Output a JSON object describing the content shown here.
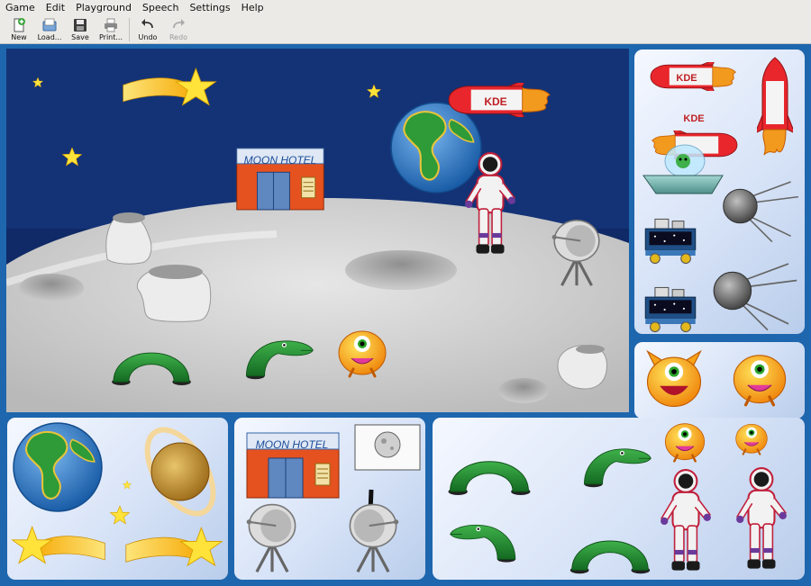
{
  "menu": {
    "items": [
      {
        "label": "Game",
        "key": "G"
      },
      {
        "label": "Edit",
        "key": "E"
      },
      {
        "label": "Playground",
        "key": "P"
      },
      {
        "label": "Speech",
        "key": "S"
      },
      {
        "label": "Settings",
        "key": "S"
      },
      {
        "label": "Help",
        "key": "H"
      }
    ]
  },
  "toolbar": {
    "new_label": "New",
    "load_label": "Load...",
    "save_label": "Save",
    "print_label": "Print...",
    "undo_label": "Undo",
    "redo_label": "Redo"
  },
  "scene": {
    "hotel_sign": "MOON HOTEL",
    "rocket_text": "KDE"
  },
  "panels": {
    "hotel_sign": "MOON HOTEL",
    "rocket_text": "KDE"
  },
  "colors": {
    "window_bg": "#eceae6",
    "stage_bg": "#1e66ad",
    "space": "#0f2a66",
    "moon": "#d2d2d2",
    "accent_red": "#e8262c"
  }
}
